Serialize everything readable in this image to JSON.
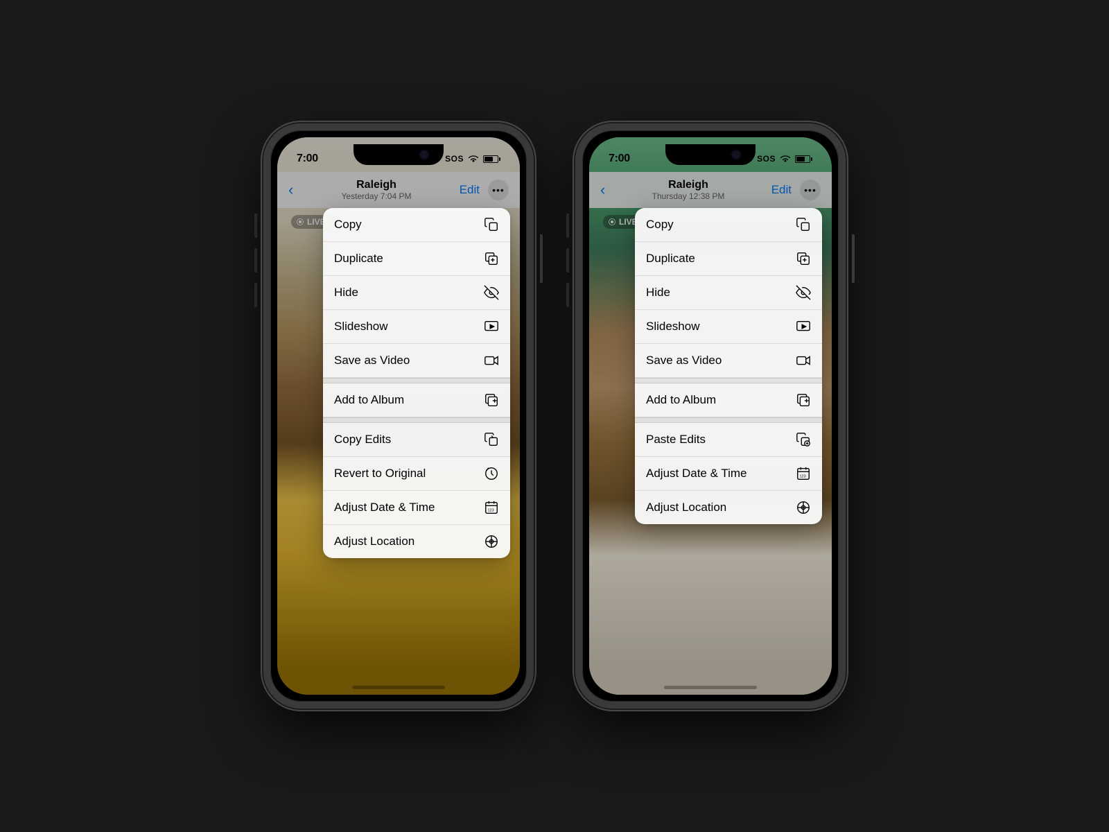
{
  "phones": [
    {
      "id": "left",
      "statusBar": {
        "time": "7:00",
        "sos": "SOS",
        "battery": "65%"
      },
      "navBar": {
        "backLabel": "Back",
        "title": "Raleigh",
        "subtitle": "Yesterday  7:04 PM",
        "editLabel": "Edit"
      },
      "liveBadge": "LIVE",
      "contextMenu": {
        "items": [
          {
            "label": "Copy",
            "icon": "copy"
          },
          {
            "label": "Duplicate",
            "icon": "duplicate"
          },
          {
            "label": "Hide",
            "icon": "hide"
          },
          {
            "label": "Slideshow",
            "icon": "slideshow"
          },
          {
            "label": "Save as Video",
            "icon": "video"
          },
          {
            "label": "Add to Album",
            "icon": "album",
            "separator_before": true
          },
          {
            "label": "Copy Edits",
            "icon": "copy-edits",
            "separator_before": true
          },
          {
            "label": "Revert to Original",
            "icon": "revert"
          },
          {
            "label": "Adjust Date & Time",
            "icon": "date-time"
          },
          {
            "label": "Adjust Location",
            "icon": "location"
          }
        ]
      }
    },
    {
      "id": "right",
      "statusBar": {
        "time": "7:00",
        "sos": "SOS",
        "battery": "65%"
      },
      "navBar": {
        "backLabel": "Back",
        "title": "Raleigh",
        "subtitle": "Thursday  12:38 PM",
        "editLabel": "Edit"
      },
      "liveBadge": "LIVE",
      "contextMenu": {
        "items": [
          {
            "label": "Copy",
            "icon": "copy"
          },
          {
            "label": "Duplicate",
            "icon": "duplicate"
          },
          {
            "label": "Hide",
            "icon": "hide"
          },
          {
            "label": "Slideshow",
            "icon": "slideshow"
          },
          {
            "label": "Save as Video",
            "icon": "video"
          },
          {
            "label": "Add to Album",
            "icon": "album",
            "separator_before": true
          },
          {
            "label": "Paste Edits",
            "icon": "paste-edits",
            "separator_before": true
          },
          {
            "label": "Adjust Date & Time",
            "icon": "date-time"
          },
          {
            "label": "Adjust Location",
            "icon": "location"
          }
        ]
      }
    }
  ]
}
